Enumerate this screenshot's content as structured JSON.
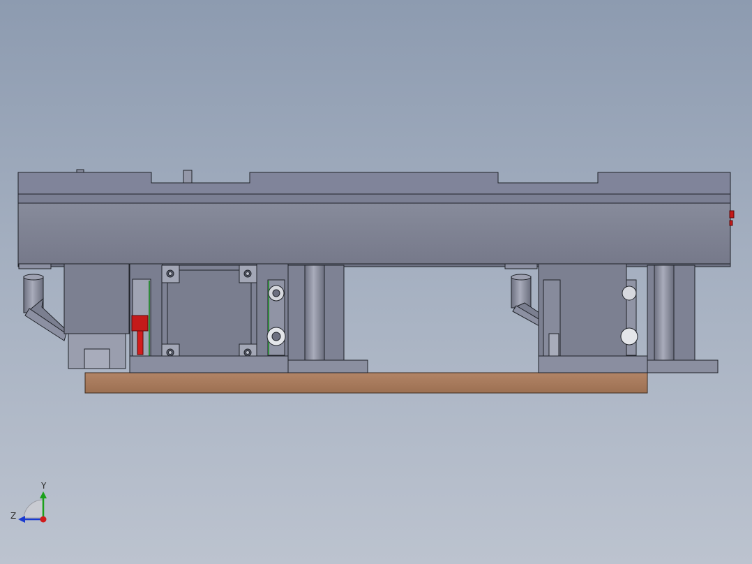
{
  "view": {
    "background_top": "#8d9bb0",
    "background_bottom": "#bcc3cf"
  },
  "model": {
    "body_color": "#7d8192",
    "body_dark": "#6a6e7e",
    "edge_color": "#1f2228",
    "base_plate_color": "#a77a5a",
    "accent_red": "#c41a1a",
    "accent_green": "#2f8a3a"
  },
  "triad": {
    "y_label": "Y",
    "z_label": "Z",
    "y_color": "#1aa01a",
    "z_color": "#1a3ad0",
    "x_color": "#d01a1a"
  }
}
